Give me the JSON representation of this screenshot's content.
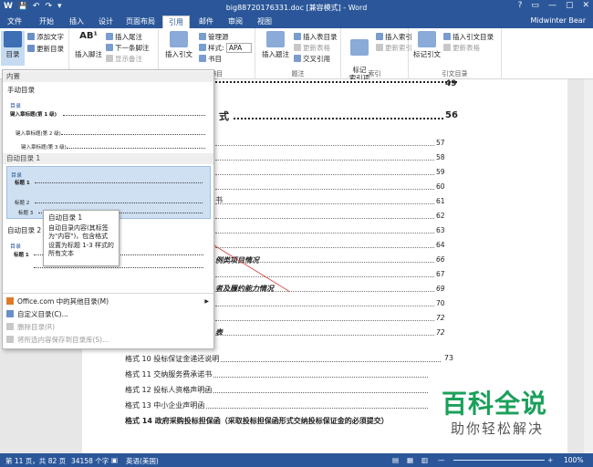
{
  "titlebar": {
    "qat": [
      "W",
      "💾",
      "↶",
      "↷",
      "▾"
    ],
    "title": "big88720176331.doc [兼容模式] - Word",
    "controls": [
      "?",
      "▭",
      "—",
      "▢",
      "✕"
    ]
  },
  "tabs": [
    {
      "label": "文件"
    },
    {
      "label": "开始"
    },
    {
      "label": "插入"
    },
    {
      "label": "设计"
    },
    {
      "label": "页面布局"
    },
    {
      "label": "引用"
    },
    {
      "label": "邮件"
    },
    {
      "label": "审阅"
    },
    {
      "label": "视图"
    }
  ],
  "user": "Midwinter Bear",
  "ribbon": {
    "toc": {
      "big": "目录",
      "add_text": "添加文字",
      "update": "更新目录",
      "label": "目录"
    },
    "footnote": {
      "big": "插入脚注",
      "insert_endnote": "插入尾注",
      "next_footnote": "下一条脚注",
      "show_notes": "显示备注",
      "label": "脚注"
    },
    "citation": {
      "big": "插入引文",
      "manage": "管理源",
      "style_label": "样式:",
      "style_value": "APA",
      "bib": "书目",
      "label": "引文与书目"
    },
    "caption": {
      "big": "插入题注",
      "insert_table": "插入表目录",
      "update_table": "更新表格",
      "crossref": "交叉引用",
      "label": "题注"
    },
    "index": {
      "big": "标记\n索引项",
      "insert": "插入索引",
      "update": "更新索引",
      "label": "索引"
    },
    "toa": {
      "big": "标记引文",
      "insert": "插入引文目录",
      "update": "更新表格",
      "label": "引文目录"
    }
  },
  "doc": {
    "top_heading_pg": "49",
    "sec_heading": "式",
    "sec_heading_pg": "56",
    "fragments": [
      "书",
      "例类项目情况",
      "者及履约能力情况",
      "表"
    ],
    "toc_pages": [
      "57",
      "58",
      "59",
      "60",
      "61",
      "62",
      "63",
      "64",
      "66",
      "67",
      "69",
      "70",
      "72",
      "72"
    ],
    "toc_items": [
      {
        "label": "格式 10 投标保证金递还说明",
        "pg": "73"
      },
      {
        "label": "格式 11 交纳服务费承诺书",
        "pg": ""
      },
      {
        "label": "格式 12 投标人资格声明函",
        "pg": ""
      },
      {
        "label": "格式 13 中小企业声明函",
        "pg": ""
      },
      {
        "label": "格式 14 政府采购投标担保函（采取投标担保函形式交纳投标保证金的必须提交）",
        "pg": ""
      }
    ]
  },
  "dropdown": {
    "builtin": "内置",
    "manual_title": "手动目录",
    "thumb_manual": {
      "heading": "目录",
      "l1": "键入章标题(第 1 级)",
      "l2": "键入章标题(第 2 级)",
      "l3": "键入章标题(第 3 级)"
    },
    "auto1_title": "自动目录 1",
    "thumb_auto1": {
      "heading": "目录",
      "l1": "标题 1",
      "l2": "标题 2",
      "l3": "标题 3"
    },
    "auto2_title": "自动目录 2",
    "thumb_auto2": {
      "heading": "目录",
      "l1": "标题 1"
    },
    "menu": [
      {
        "label": "Office.com 中的其他目录(M)",
        "disabled": false,
        "arrow": "▶"
      },
      {
        "label": "自定义目录(C)...",
        "disabled": false,
        "arrow": ""
      },
      {
        "label": "删除目录(R)",
        "disabled": true,
        "arrow": ""
      },
      {
        "label": "将所选内容保存到目录库(S)...",
        "disabled": true,
        "arrow": ""
      }
    ]
  },
  "tooltip": {
    "title": "自动目录 1",
    "body": "自动目录内容(其标签为\"内容\")，包含格式设置为标题 1-3 样式的所有文本"
  },
  "status": {
    "page": "第 11 页，共 82 页",
    "words": "34158 个字",
    "lang": "英语(美国)",
    "zoom": "100%"
  },
  "watermark": {
    "main": "百科全说",
    "sub": "助你轻松解决"
  },
  "colors": {
    "brand": "#2b579a",
    "watermark": "#1aa05a",
    "selection": "#cfe0f3"
  }
}
